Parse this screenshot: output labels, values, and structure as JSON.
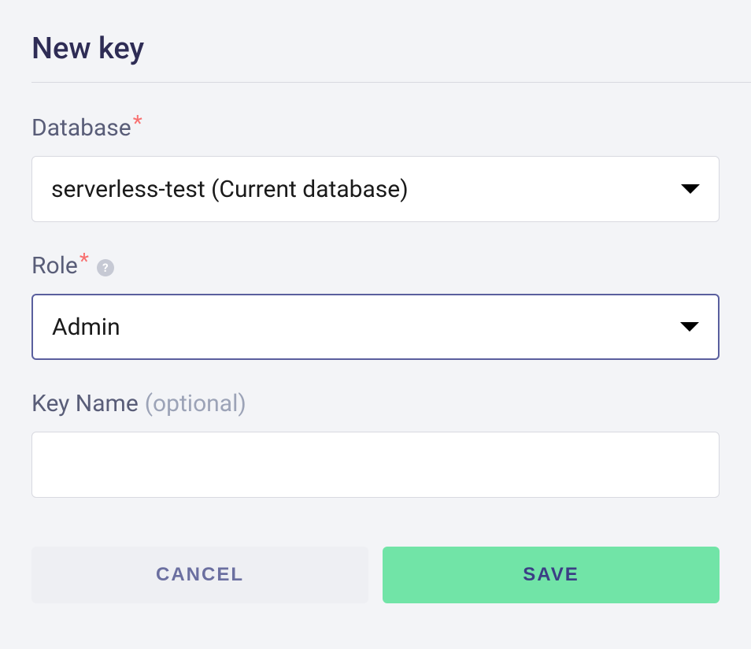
{
  "page": {
    "title": "New key"
  },
  "fields": {
    "database": {
      "label": "Database",
      "required_marker": "*",
      "value": "serverless-test (Current database)"
    },
    "role": {
      "label": "Role",
      "required_marker": "*",
      "help_symbol": "?",
      "value": "Admin"
    },
    "key_name": {
      "label": "Key Name",
      "optional_text": "(optional)",
      "value": ""
    }
  },
  "buttons": {
    "cancel": "CANCEL",
    "save": "SAVE"
  }
}
